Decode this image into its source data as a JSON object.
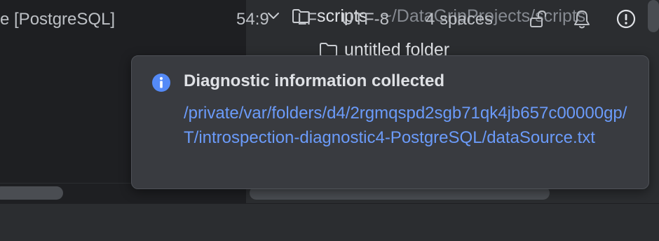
{
  "project_tree": {
    "scripts_folder": {
      "name": "scripts",
      "path": "~/DataGripProjects/scripts",
      "icon": "folder-icon",
      "expanded": true
    },
    "child_folder": {
      "name": "untitled folder",
      "icon": "folder-icon"
    }
  },
  "notification": {
    "icon": "info-icon",
    "title": "Diagnostic information collected",
    "link": "/private/var/folders/d4/2rgmqspd2sgb71qk4jb657c00000gp/T/introspection-diagnostic4-PostgreSQL/dataSource.txt"
  },
  "status_bar": {
    "datasource": "e [PostgreSQL]",
    "position": "54:9",
    "line_separator": "LF",
    "encoding": "UTF-8",
    "indent": "4 spaces",
    "icons": [
      "lock-open-icon",
      "bell-icon",
      "exclamation-circle-icon"
    ]
  },
  "colors": {
    "editor_bg": "#1e1f22",
    "panel_bg": "#2b2d30",
    "popup_bg": "#393b40",
    "link": "#6b9bfa",
    "info_accent": "#548af7"
  }
}
